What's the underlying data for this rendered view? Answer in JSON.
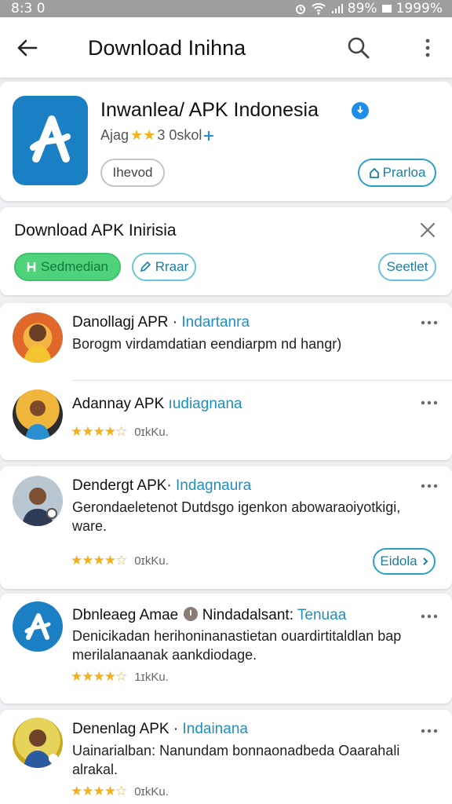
{
  "status_bar": {
    "time": "8:3 0",
    "battery_pct": "89%",
    "signal": "1999%"
  },
  "app_bar": {
    "title": "Download Inihna"
  },
  "hero": {
    "app_name": "Inwanlea/ APK Indonesia",
    "meta_prefix": "Ajag",
    "meta_stars": "★★",
    "meta_text": "3 0skol",
    "install_label": "Ihevod",
    "preview_label": "Prarloa"
  },
  "filter": {
    "heading": "Download APK Inirisia",
    "chips": [
      {
        "label": "Sedmedian",
        "icon": "grid-icon"
      },
      {
        "label": "Rraar",
        "icon": "edit-icon"
      },
      {
        "label": "Seetlet"
      }
    ]
  },
  "feed": [
    {
      "title": "Danollagj APR ·",
      "tag": "Indartanra",
      "desc": "Borogm virdamdatian eendiarpm nd hangr)"
    },
    {
      "title": "Adannay APK",
      "tag": "ıudiagnana",
      "rating_stars": "★★★★☆",
      "rating_count": "0ɪkKu."
    },
    {
      "title": "Dendergt APK·",
      "tag": "Indagnaura",
      "desc": "Gerondaeletenot Dutdsgo igenkon abowaraoiyotkigi, ware.",
      "rating_stars": "★★★★☆",
      "rating_count": "0ɪkKu.",
      "button": "Eidola"
    },
    {
      "title": "Dbnleaeg Amae",
      "title2": "Nindadalsant:",
      "tag": "Tenuaa",
      "desc": "Denicikadan herihoninanastietan ouardirtitaldlan bap merilalanaanak aankdiodage.",
      "rating_stars": "★★★★☆",
      "rating_count": "1ɪkKu."
    },
    {
      "title": "Denenlag APK ·",
      "tag": "Indainana",
      "desc": "Uainarialban: Nanundam bonnaonadbeda Oaarahali alrakal.",
      "rating_stars": "★★★★☆",
      "rating_count": "0ɪkKu."
    }
  ]
}
